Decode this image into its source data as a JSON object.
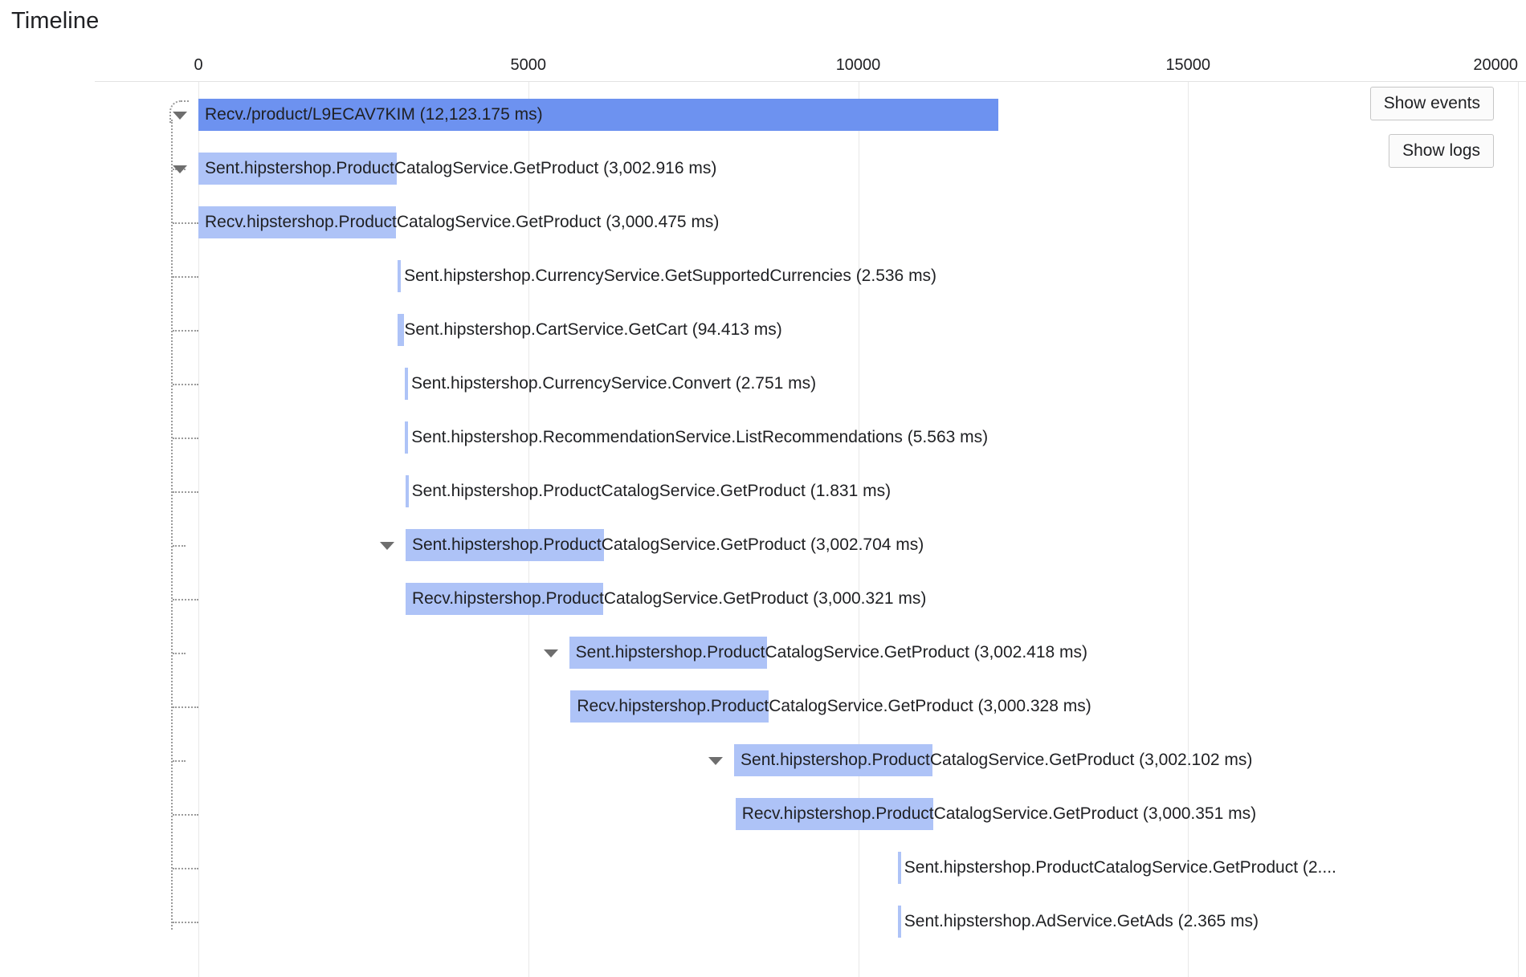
{
  "page": {
    "title": "Timeline"
  },
  "toolbar": {
    "show_events_label": "Show events",
    "show_logs_label": "Show logs"
  },
  "chart_data": {
    "type": "bar",
    "subtype": "gantt-trace-waterfall",
    "title": "Timeline",
    "xlabel": "",
    "ylabel": "",
    "xlim": [
      0,
      20000
    ],
    "x_unit": "ms",
    "ticks": [
      0,
      5000,
      10000,
      15000,
      20000
    ],
    "tick_labels": [
      "0",
      "5000",
      "10000",
      "15000",
      "20000"
    ],
    "grid": true,
    "legend": false,
    "colors": {
      "root_bar": "#6d92f0",
      "child_bar": "#aec3f7",
      "gridline": "#e8e8e8",
      "text": "#202124",
      "tree_line": "#9b9b9b"
    },
    "spans": [
      {
        "label": "Recv./product/L9ECAV7KIM (12,123.175 ms)",
        "name": "Recv./product/L9ECAV7KIM",
        "duration_ms": 12123.175,
        "start_ms": 0,
        "depth": 0,
        "root": true,
        "expandable": true
      },
      {
        "label": "Sent.hipstershop.ProductCatalogService.GetProduct (3,002.916 ms)",
        "name": "Sent.hipstershop.ProductCatalogService.GetProduct",
        "duration_ms": 3002.916,
        "start_ms": 0,
        "depth": 1,
        "root": false,
        "expandable": true
      },
      {
        "label": "Recv.hipstershop.ProductCatalogService.GetProduct (3,000.475 ms)",
        "name": "Recv.hipstershop.ProductCatalogService.GetProduct",
        "duration_ms": 3000.475,
        "start_ms": 0,
        "depth": 2,
        "root": false,
        "expandable": false
      },
      {
        "label": "Sent.hipstershop.CurrencyService.GetSupportedCurrencies (2.536 ms)",
        "name": "Sent.hipstershop.CurrencyService.GetSupportedCurrencies",
        "duration_ms": 2.536,
        "start_ms": 3020,
        "depth": 2,
        "root": false,
        "expandable": false
      },
      {
        "label": "Sent.hipstershop.CartService.GetCart (94.413 ms)",
        "name": "Sent.hipstershop.CartService.GetCart",
        "duration_ms": 94.413,
        "start_ms": 3024,
        "depth": 2,
        "root": false,
        "expandable": false
      },
      {
        "label": "Sent.hipstershop.CurrencyService.Convert (2.751 ms)",
        "name": "Sent.hipstershop.CurrencyService.Convert",
        "duration_ms": 2.751,
        "start_ms": 3128,
        "depth": 2,
        "root": false,
        "expandable": false
      },
      {
        "label": "Sent.hipstershop.RecommendationService.ListRecommendations (5.563 ms)",
        "name": "Sent.hipstershop.RecommendationService.ListRecommendations",
        "duration_ms": 5.563,
        "start_ms": 3132,
        "depth": 2,
        "root": false,
        "expandable": false
      },
      {
        "label": "Sent.hipstershop.ProductCatalogService.GetProduct (1.831 ms)",
        "name": "Sent.hipstershop.ProductCatalogService.GetProduct",
        "duration_ms": 1.831,
        "start_ms": 3136,
        "depth": 2,
        "root": false,
        "expandable": false
      },
      {
        "label": "Sent.hipstershop.ProductCatalogService.GetProduct (3,002.704 ms)",
        "name": "Sent.hipstershop.ProductCatalogService.GetProduct",
        "duration_ms": 3002.704,
        "start_ms": 3140,
        "depth": 2,
        "root": false,
        "expandable": true
      },
      {
        "label": "Recv.hipstershop.ProductCatalogService.GetProduct (3,000.321 ms)",
        "name": "Recv.hipstershop.ProductCatalogService.GetProduct",
        "duration_ms": 3000.321,
        "start_ms": 3140,
        "depth": 3,
        "root": false,
        "expandable": false
      },
      {
        "label": "Sent.hipstershop.ProductCatalogService.GetProduct (3,002.418 ms)",
        "name": "Sent.hipstershop.ProductCatalogService.GetProduct",
        "duration_ms": 3002.418,
        "start_ms": 5620,
        "depth": 3,
        "root": false,
        "expandable": true
      },
      {
        "label": "Recv.hipstershop.ProductCatalogService.GetProduct (3,000.328 ms)",
        "name": "Recv.hipstershop.ProductCatalogService.GetProduct",
        "duration_ms": 3000.328,
        "start_ms": 5640,
        "depth": 4,
        "root": false,
        "expandable": false
      },
      {
        "label": "Sent.hipstershop.ProductCatalogService.GetProduct (3,002.102 ms)",
        "name": "Sent.hipstershop.ProductCatalogService.GetProduct",
        "duration_ms": 3002.102,
        "start_ms": 8120,
        "depth": 4,
        "root": false,
        "expandable": true
      },
      {
        "label": "Recv.hipstershop.ProductCatalogService.GetProduct (3,000.351 ms)",
        "name": "Recv.hipstershop.ProductCatalogService.GetProduct",
        "duration_ms": 3000.351,
        "start_ms": 8140,
        "depth": 5,
        "root": false,
        "expandable": false
      },
      {
        "label": "Sent.hipstershop.ProductCatalogService.GetProduct (2....",
        "name": "Sent.hipstershop.ProductCatalogService.GetProduct",
        "duration_ms": 2.0,
        "start_ms": 10600,
        "depth": 5,
        "root": false,
        "expandable": false
      },
      {
        "label": "Sent.hipstershop.AdService.GetAds (2.365 ms)",
        "name": "Sent.hipstershop.AdService.GetAds",
        "duration_ms": 2.365,
        "start_ms": 10600,
        "depth": 5,
        "root": false,
        "expandable": false
      }
    ]
  }
}
